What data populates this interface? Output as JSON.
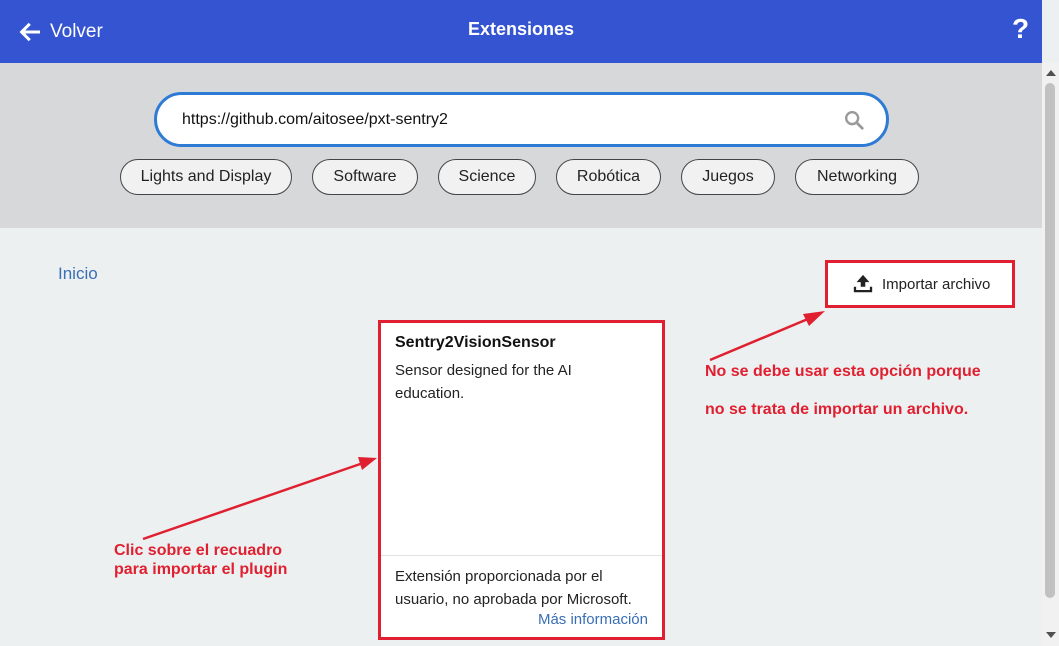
{
  "header": {
    "back_label": "Volver",
    "title": "Extensiones",
    "help_label": "?"
  },
  "search": {
    "value": "https://github.com/aitosee/pxt-sentry2"
  },
  "categories": [
    "Lights and Display",
    "Software",
    "Science",
    "Robótica",
    "Juegos",
    "Networking"
  ],
  "breadcrumb": {
    "home": "Inicio"
  },
  "import": {
    "label": "Importar archivo"
  },
  "extension_card": {
    "title": "Sentry2VisionSensor",
    "description": "Sensor designed for the AI education.",
    "footer": "Extensión proporcionada por el usuario, no aprobada por Microsoft.",
    "more_link": "Más información"
  },
  "annotations": {
    "import_note_line1": "No se debe usar esta opción porque",
    "import_note_line2": "no se trata de importar un archivo.",
    "card_note_line1": "Clic sobre el recuadro",
    "card_note_line2": "para importar el plugin"
  },
  "colors": {
    "header_bg": "#3454d1",
    "search_border": "#2e7bd6",
    "annotation_red": "#e02030",
    "link_blue": "#3a6fb5"
  }
}
